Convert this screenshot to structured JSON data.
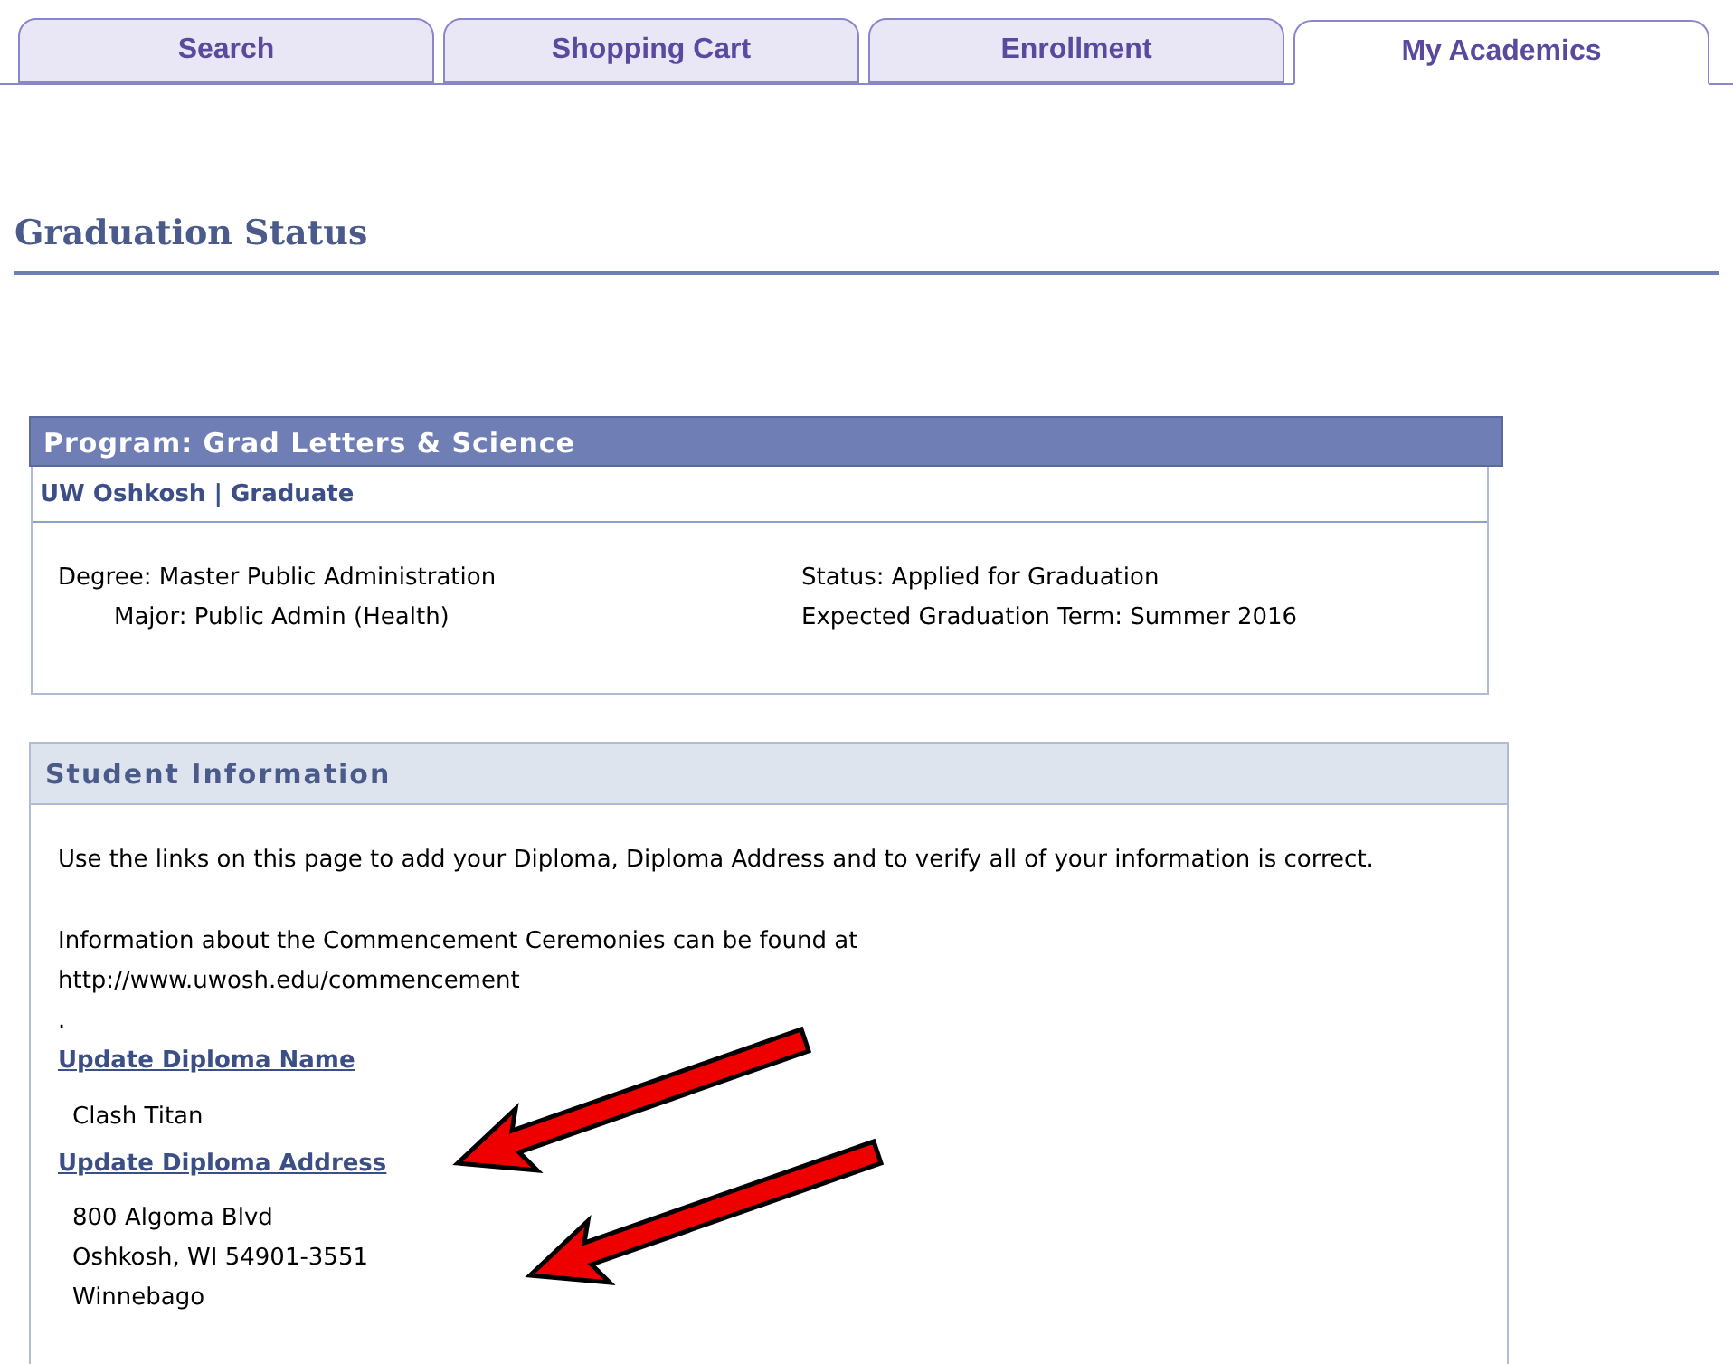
{
  "tabs": [
    {
      "label": "Search",
      "selected": false
    },
    {
      "label": "Shopping Cart",
      "selected": false
    },
    {
      "label": "Enrollment",
      "selected": false
    },
    {
      "label": "My Academics",
      "selected": true
    }
  ],
  "page_title": "Graduation Status",
  "program": {
    "title": "Program: Grad Letters & Science",
    "institution": "UW Oshkosh | Graduate",
    "degree": "Degree: Master Public Administration",
    "major": "Major: Public Admin (Health)",
    "status": "Status: Applied for Graduation",
    "expected_term": "Expected Graduation Term: Summer 2016"
  },
  "student_information": {
    "title": "Student Information",
    "intro": "Use the links on this page to add your Diploma, Diploma Address and to verify all of your information is correct.",
    "commencement_text": "Information about the Commencement Ceremonies can be found at",
    "commencement_url": "http://www.uwosh.edu/commencement",
    "period": ".",
    "name_link": "Update Diploma Name",
    "diploma_name": "Clash Titan",
    "address_link": "Update Diploma Address",
    "address_lines": [
      "800 Algoma Blvd",
      "Oshkosh, WI 54901-3551",
      "Winnebago"
    ]
  }
}
